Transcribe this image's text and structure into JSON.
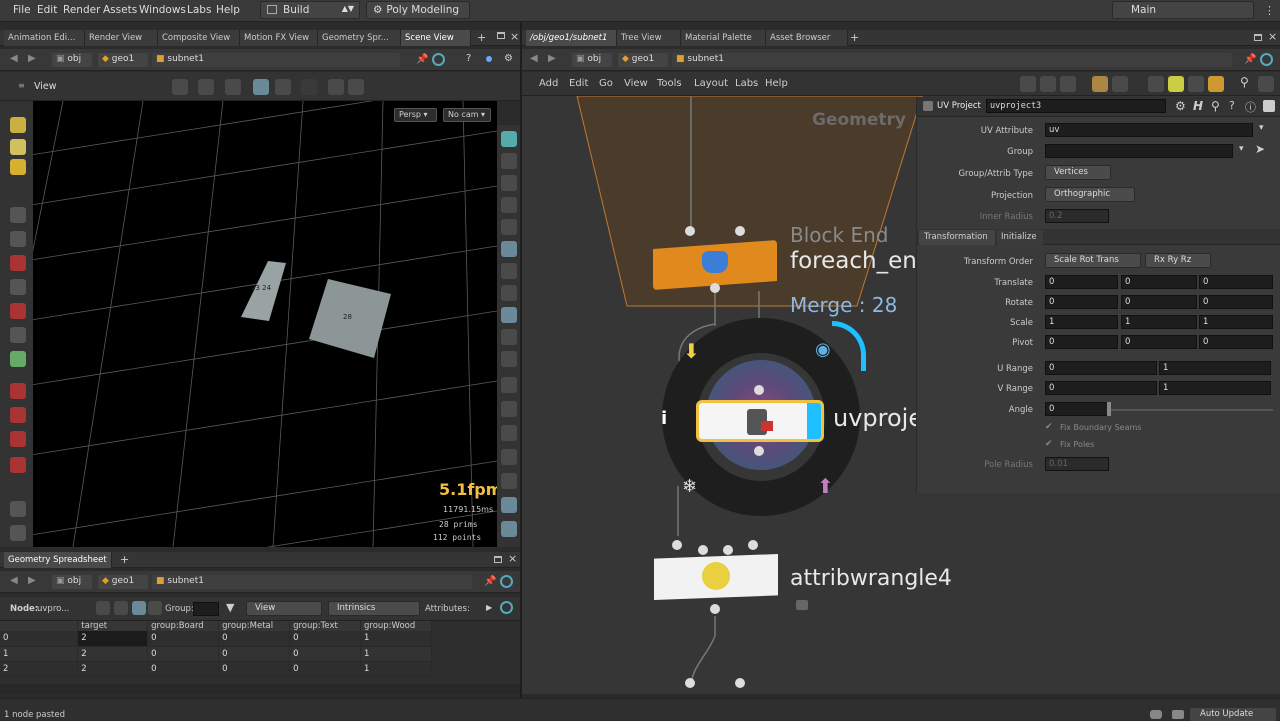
{
  "menubar": {
    "items": [
      "File",
      "Edit",
      "Render",
      "Assets",
      "Windows",
      "Labs",
      "Help"
    ],
    "desktop": "Build",
    "shelf": "Poly Modeling",
    "workspace": "Main"
  },
  "left_tabs": [
    "Animation Edi...",
    "Render View",
    "Composite View",
    "Motion FX View",
    "Geometry Spr...",
    "Scene View"
  ],
  "right_tabs": [
    "/obj/geo1/subnet1",
    "Tree View",
    "Material Palette",
    "Asset Browser"
  ],
  "path": {
    "obj": "obj",
    "geo": "geo1",
    "subnet": "subnet1"
  },
  "viewport": {
    "title": "View",
    "persp": "Persp",
    "cam": "No cam",
    "fps": "5.1fpm",
    "ms": "11791.15ms",
    "prims_label": "28  prims",
    "points_label": "112 points",
    "quad_a_label": "23 24",
    "quad_b_label": "28"
  },
  "spreadsheet": {
    "tab": "Geometry Spreadsheet",
    "node_label": "Node:",
    "node_value": "uvpro...",
    "group_label": "Group:",
    "view_label": "View",
    "intrinsics_label": "Intrinsics",
    "attributes_label": "Attributes:",
    "columns": [
      "",
      "target",
      "group:Board",
      "group:Metal",
      "group:Text",
      "group:Wood"
    ],
    "rows": [
      [
        "0",
        "2",
        "0",
        "0",
        "0",
        "1"
      ],
      [
        "1",
        "2",
        "0",
        "0",
        "0",
        "1"
      ],
      [
        "2",
        "2",
        "0",
        "0",
        "0",
        "1"
      ]
    ]
  },
  "net_menu": [
    "Add",
    "Edit",
    "Go",
    "View",
    "Tools",
    "Layout",
    "Labs",
    "Help"
  ],
  "network": {
    "geometry_label": "Geometry",
    "block_end_type": "Block End",
    "block_end_name": "foreach_en",
    "merge_label": "Merge : 28",
    "uvproject_name": "uvproje",
    "attribwrangle_name": "attribwrangle4"
  },
  "params": {
    "node_type": "UV Project",
    "node_name": "uvproject3",
    "uv_attribute_label": "UV Attribute",
    "uv_attribute_value": "uv",
    "group_label": "Group",
    "group_type_label": "Group/Attrib Type",
    "group_type_value": "Vertices",
    "projection_label": "Projection",
    "projection_value": "Orthographic",
    "inner_radius_label": "Inner Radius",
    "inner_radius_value": "0.2",
    "tab_transform": "Transformation",
    "tab_initialize": "Initialize",
    "transform_order_label": "Transform Order",
    "transform_order_value": "Scale Rot Trans",
    "rot_order_value": "Rx Ry Rz",
    "translate_label": "Translate",
    "translate": [
      "0",
      "0",
      "0"
    ],
    "rotate_label": "Rotate",
    "rotate": [
      "0",
      "0",
      "0"
    ],
    "scale_label": "Scale",
    "scale": [
      "1",
      "1",
      "1"
    ],
    "pivot_label": "Pivot",
    "pivot": [
      "0",
      "0",
      "0"
    ],
    "urange_label": "U Range",
    "urange": [
      "0",
      "1"
    ],
    "vrange_label": "V Range",
    "vrange": [
      "0",
      "1"
    ],
    "angle_label": "Angle",
    "angle_value": "0",
    "fix_seams_label": "Fix Boundary Seams",
    "fix_poles_label": "Fix Poles",
    "pole_radius_label": "Pole Radius",
    "pole_radius_value": "0.01"
  },
  "status": {
    "left": "1 node pasted",
    "right": "Auto Update"
  },
  "colors": {
    "orange": "#e08a1e",
    "blue_accent": "#1ec0ff",
    "yellow_fps": "#f0c040"
  }
}
